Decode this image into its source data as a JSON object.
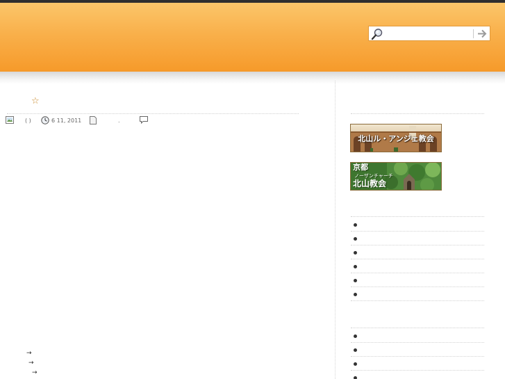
{
  "header": {
    "search": {
      "placeholder": "",
      "value": ""
    }
  },
  "post": {
    "meta": {
      "paren_text": "( )",
      "date_text": "6 11, 2011",
      "dot_text": "."
    },
    "links": [
      {
        "arrow": "→"
      },
      {
        "arrow": "→"
      },
      {
        "arrow": "→"
      }
    ]
  },
  "sidebar": {
    "banners": [
      {
        "text": "北山ル・アンジェ教会"
      },
      {
        "text_line1": "京都",
        "text_small": "ノーザンチャーチ",
        "text_line2": "北山教会"
      }
    ],
    "list_a_count": 6,
    "list_b_count": 4
  },
  "colors": {
    "header_top": "#fbc66a",
    "header_bottom": "#f69a2a",
    "topbar": "#2f2f2f",
    "banner_border": "#8a6a3a"
  }
}
